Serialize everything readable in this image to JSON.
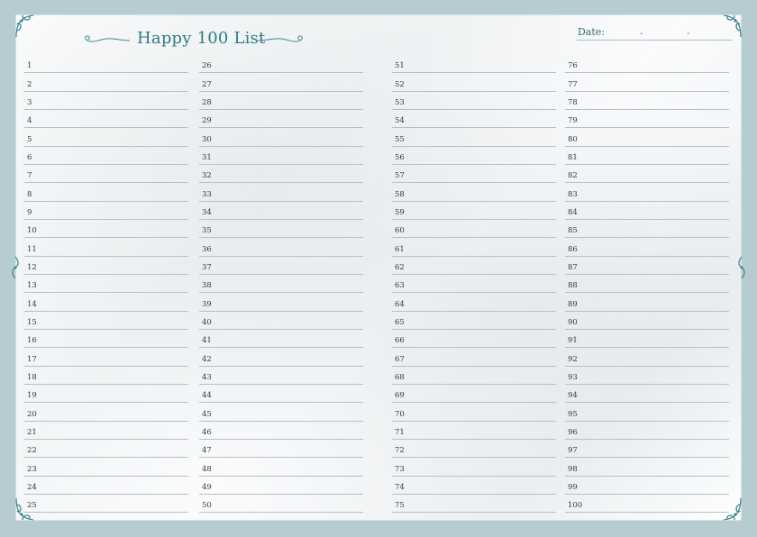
{
  "header": {
    "title": "Happy 100 List",
    "date_label": "Date:",
    "date_separator": "."
  },
  "columns": [
    {
      "numbers": [
        "1",
        "2",
        "3",
        "4",
        "5",
        "6",
        "7",
        "8",
        "9",
        "10",
        "11",
        "12",
        "13",
        "14",
        "15",
        "16",
        "17",
        "18",
        "19",
        "20",
        "21",
        "22",
        "23",
        "24",
        "25"
      ]
    },
    {
      "numbers": [
        "26",
        "27",
        "28",
        "29",
        "30",
        "31",
        "32",
        "33",
        "34",
        "35",
        "36",
        "37",
        "38",
        "39",
        "40",
        "41",
        "42",
        "43",
        "44",
        "45",
        "46",
        "47",
        "48",
        "49",
        "50"
      ]
    },
    {
      "numbers": [
        "51",
        "52",
        "53",
        "54",
        "55",
        "56",
        "57",
        "58",
        "59",
        "60",
        "61",
        "62",
        "63",
        "64",
        "65",
        "66",
        "67",
        "68",
        "69",
        "70",
        "71",
        "72",
        "73",
        "74",
        "75"
      ]
    },
    {
      "numbers": [
        "76",
        "77",
        "78",
        "79",
        "80",
        "81",
        "82",
        "83",
        "84",
        "85",
        "86",
        "87",
        "88",
        "89",
        "90",
        "91",
        "92",
        "93",
        "94",
        "95",
        "96",
        "97",
        "98",
        "99",
        "100"
      ]
    }
  ],
  "colors": {
    "accent": "#2f7b82",
    "border": "#b7ccd1",
    "rule": "#b2c2c7"
  },
  "icons": [
    "corner-ornament-icon",
    "swirl-ornament-icon",
    "side-ornament-icon"
  ]
}
